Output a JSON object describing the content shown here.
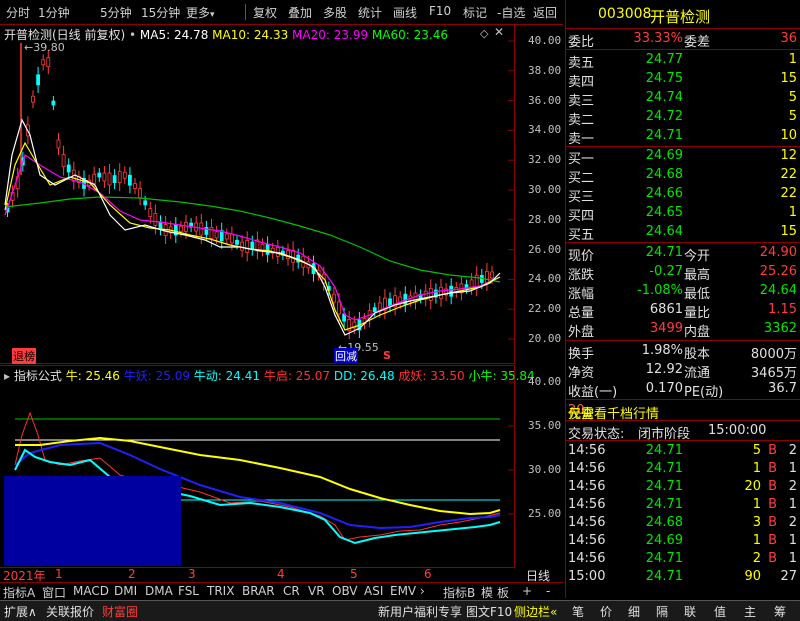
{
  "toolbar": {
    "items": [
      "分时",
      "1分钟",
      "5分钟",
      "15分钟",
      "更多",
      "复权",
      "叠加",
      "多股",
      "统计",
      "画线",
      "F10",
      "自选",
      "返回"
    ],
    "more_arrow": "▾",
    "plus": "+"
  },
  "main_chart": {
    "title": "开普检测(日线 前复权)",
    "ma": [
      {
        "label": "MA5: 24.78",
        "color": "#ffffff"
      },
      {
        "label": "MA10: 24.33",
        "color": "#ffff00"
      },
      {
        "label": "MA20: 23.99",
        "color": "#ff00ff"
      },
      {
        "label": "MA60: 23.46",
        "color": "#00ff00"
      }
    ],
    "high_label": "39.80",
    "low_label": "19.55",
    "tag_left": "退榜",
    "tag_mid": "回减",
    "tag_s": "S",
    "y_ticks": [
      "40.00",
      "38.00",
      "36.00",
      "34.00",
      "32.00",
      "30.00",
      "28.00",
      "26.00",
      "24.00",
      "22.00",
      "20.00"
    ]
  },
  "indicator_chart": {
    "title": "指标公式",
    "legend": [
      {
        "label": "牛: 25.46",
        "color": "#ffff00"
      },
      {
        "label": "牛妖: 25.09",
        "color": "#2020ff"
      },
      {
        "label": "牛动: 24.41",
        "color": "#00ffff"
      },
      {
        "label": "牛启: 25.07",
        "color": "#ff3030"
      },
      {
        "label": "DD: 26.48",
        "color": "#00ffff"
      },
      {
        "label": "成妖: 33.50",
        "color": "#ff3030"
      },
      {
        "label": "小牛: 35.84",
        "color": "#00ff00"
      }
    ],
    "y_ticks": [
      "40.00",
      "35.00",
      "30.00",
      "25.00"
    ]
  },
  "x_axis": {
    "year": "2021年",
    "months": [
      "1",
      "2",
      "3",
      "4",
      "5",
      "6"
    ],
    "period_label": "日线"
  },
  "bottom_tabs": [
    "指标A",
    "窗口",
    "MACD",
    "DMI",
    "DMA",
    "FSL",
    "TRIX",
    "BRAR",
    "CR",
    "VR",
    "OBV",
    "ASI",
    "EMV",
    "指标B",
    "模",
    "板",
    "+",
    "-"
  ],
  "status_bar": {
    "left": [
      "扩展∧",
      "关联报价",
      "财富圈"
    ],
    "mid": [
      "新用户福利专享",
      "图文F10",
      "侧边栏«"
    ],
    "right": [
      "笔",
      "价",
      "细",
      "隔",
      "联",
      "值",
      "主",
      "筹"
    ]
  },
  "quote": {
    "code": "003008",
    "name": "开普检测",
    "webi_label": "委比",
    "webi_value": "33.33%",
    "weicha_label": "委差",
    "weicha_value": "36",
    "sell": [
      {
        "label": "卖五",
        "price": "24.77",
        "vol": "1"
      },
      {
        "label": "卖四",
        "price": "24.75",
        "vol": "15"
      },
      {
        "label": "卖三",
        "price": "24.74",
        "vol": "5"
      },
      {
        "label": "卖二",
        "price": "24.72",
        "vol": "5"
      },
      {
        "label": "卖一",
        "price": "24.71",
        "vol": "10"
      }
    ],
    "buy": [
      {
        "label": "买一",
        "price": "24.69",
        "vol": "12"
      },
      {
        "label": "买二",
        "price": "24.68",
        "vol": "22"
      },
      {
        "label": "买三",
        "price": "24.66",
        "vol": "22"
      },
      {
        "label": "买四",
        "price": "24.65",
        "vol": "1"
      },
      {
        "label": "买五",
        "price": "24.64",
        "vol": "15"
      }
    ],
    "stats": [
      {
        "l1": "现价",
        "v1": "24.71",
        "c1": "green",
        "l2": "今开",
        "v2": "24.90",
        "c2": "red"
      },
      {
        "l1": "涨跌",
        "v1": "-0.27",
        "c1": "green",
        "l2": "最高",
        "v2": "25.26",
        "c2": "red"
      },
      {
        "l1": "涨幅",
        "v1": "-1.08%",
        "c1": "green",
        "l2": "最低",
        "v2": "24.64",
        "c2": "green"
      },
      {
        "l1": "总量",
        "v1": "6861",
        "c1": "white",
        "l2": "量比",
        "v2": "1.15",
        "c2": "red"
      },
      {
        "l1": "外盘",
        "v1": "3499",
        "c1": "red",
        "l2": "内盘",
        "v2": "3362",
        "c2": "green"
      }
    ],
    "fund": [
      {
        "l1": "换手",
        "v1": "1.98%",
        "l2": "股本",
        "v2": "8000万"
      },
      {
        "l1": "净资",
        "v1": "12.92",
        "l2": "流通",
        "v2": "3465万"
      },
      {
        "l1": "收益(一)",
        "v1": "0.170",
        "l2": "PE(动)",
        "v2": "36.7"
      }
    ],
    "promo_1": "仅需",
    "promo_num": "20",
    "promo_2": "元查看千档行情",
    "trade_status_label": "交易状态:",
    "trade_status_value": "闭市阶段",
    "trade_status_time": "15:00:00",
    "ticks": [
      {
        "time": "14:56",
        "price": "24.71",
        "vol": "5",
        "bs": "B",
        "n": "2",
        "pc": "green"
      },
      {
        "time": "14:56",
        "price": "24.71",
        "vol": "1",
        "bs": "B",
        "n": "1",
        "pc": "green"
      },
      {
        "time": "14:56",
        "price": "24.71",
        "vol": "20",
        "bs": "B",
        "n": "2",
        "pc": "green"
      },
      {
        "time": "14:56",
        "price": "24.71",
        "vol": "1",
        "bs": "B",
        "n": "1",
        "pc": "green"
      },
      {
        "time": "14:56",
        "price": "24.68",
        "vol": "3",
        "bs": "B",
        "n": "2",
        "pc": "green"
      },
      {
        "time": "14:56",
        "price": "24.69",
        "vol": "1",
        "bs": "B",
        "n": "1",
        "pc": "green"
      },
      {
        "time": "14:56",
        "price": "24.71",
        "vol": "2",
        "bs": "B",
        "n": "1",
        "pc": "green"
      },
      {
        "time": "15:00",
        "price": "24.71",
        "vol": "90",
        "bs": "",
        "n": "27",
        "pc": "green"
      }
    ]
  }
}
